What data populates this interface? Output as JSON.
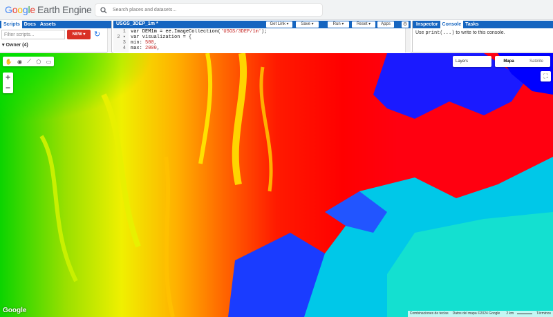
{
  "app": {
    "logo_google": [
      "G",
      "o",
      "o",
      "g",
      "l",
      "e"
    ],
    "logo_product": "Earth Engine"
  },
  "search": {
    "placeholder": "Search places and datasets..."
  },
  "left_panel": {
    "tabs": [
      "Scripts",
      "Docs",
      "Assets"
    ],
    "filter_placeholder": "Filter scripts...",
    "new_label": "NEW ▾",
    "owner_label": "▾  Owner (4)"
  },
  "editor": {
    "title": "USGS_3DEP_1m *",
    "buttons": {
      "get_link": "Get Link  ▾",
      "save": "Save  ▾",
      "run": "Run  ▾",
      "reset": "Reset  ▾",
      "apps": "Apps"
    },
    "line_numbers": [
      "1",
      "2 ▾",
      "3",
      "4"
    ],
    "lines": {
      "l1a": "var DEM1m = ee.ImageCollection(",
      "l1b": "'USGS/3DEP/1m'",
      "l1c": ");",
      "l2": "var visualization = {",
      "l3a": "  min: ",
      "l3b": "500",
      "l3c": ",",
      "l4a": "  max: ",
      "l4b": "2000",
      "l4c": ","
    }
  },
  "right_panel": {
    "tabs": [
      "Inspector",
      "Console",
      "Tasks"
    ],
    "console_pre": "Use ",
    "console_code": "print(...)",
    "console_post": " to write to this console."
  },
  "map": {
    "layers_label": "Layers",
    "map_types": [
      "Mapa",
      "Satélite"
    ],
    "selected_map_type": "Mapa",
    "google_mark": "Google",
    "attribution": {
      "shortcuts": "Combinaciones de teclas",
      "data": "Datos del mapa ©2024 Google",
      "scale": "2 km",
      "terms": "Términos"
    },
    "colors": {
      "accent_blue": "#1565c0",
      "new_red": "#d93025"
    }
  }
}
